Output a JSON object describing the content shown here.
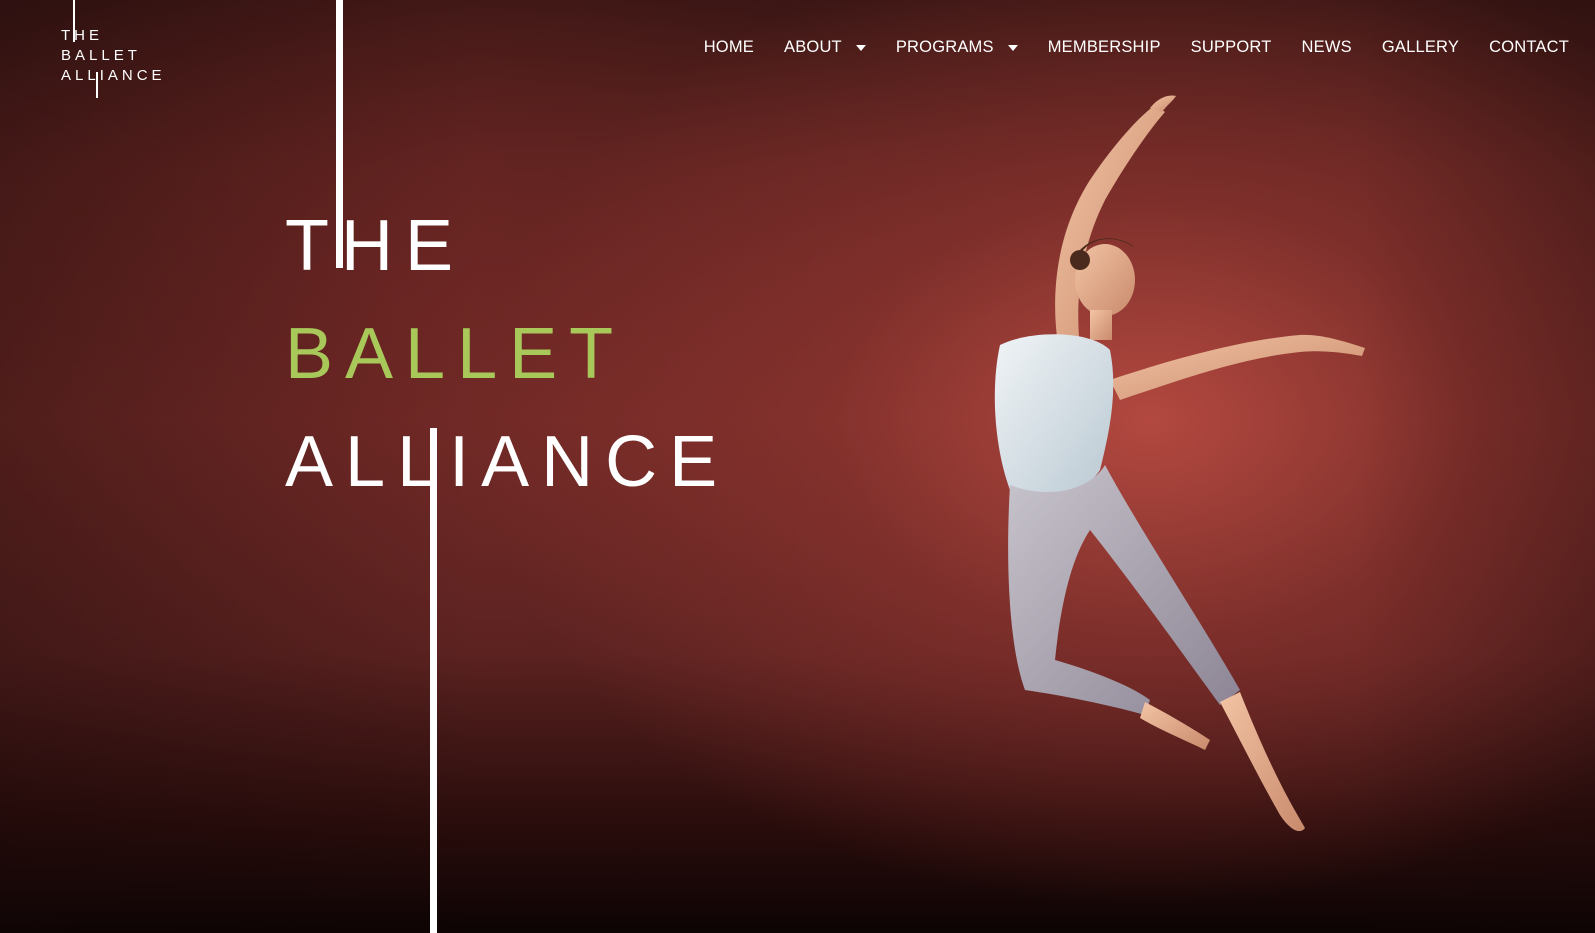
{
  "logo": {
    "lines": [
      "THE",
      "BALLET",
      "ALLIANCE"
    ]
  },
  "nav": {
    "items": [
      {
        "label": "HOME",
        "dropdown": false
      },
      {
        "label": "ABOUT",
        "dropdown": true
      },
      {
        "label": "PROGRAMS",
        "dropdown": true
      },
      {
        "label": "MEMBERSHIP",
        "dropdown": false
      },
      {
        "label": "SUPPORT",
        "dropdown": false
      },
      {
        "label": "NEWS",
        "dropdown": false
      },
      {
        "label": "GALLERY",
        "dropdown": false
      },
      {
        "label": "CONTACT",
        "dropdown": false
      }
    ]
  },
  "hero": {
    "title_line1": "THE",
    "title_line2": "BALLET",
    "title_line3": "ALLIANCE",
    "accent_color": "#a8c85a",
    "background_color": "#6e2a26"
  }
}
